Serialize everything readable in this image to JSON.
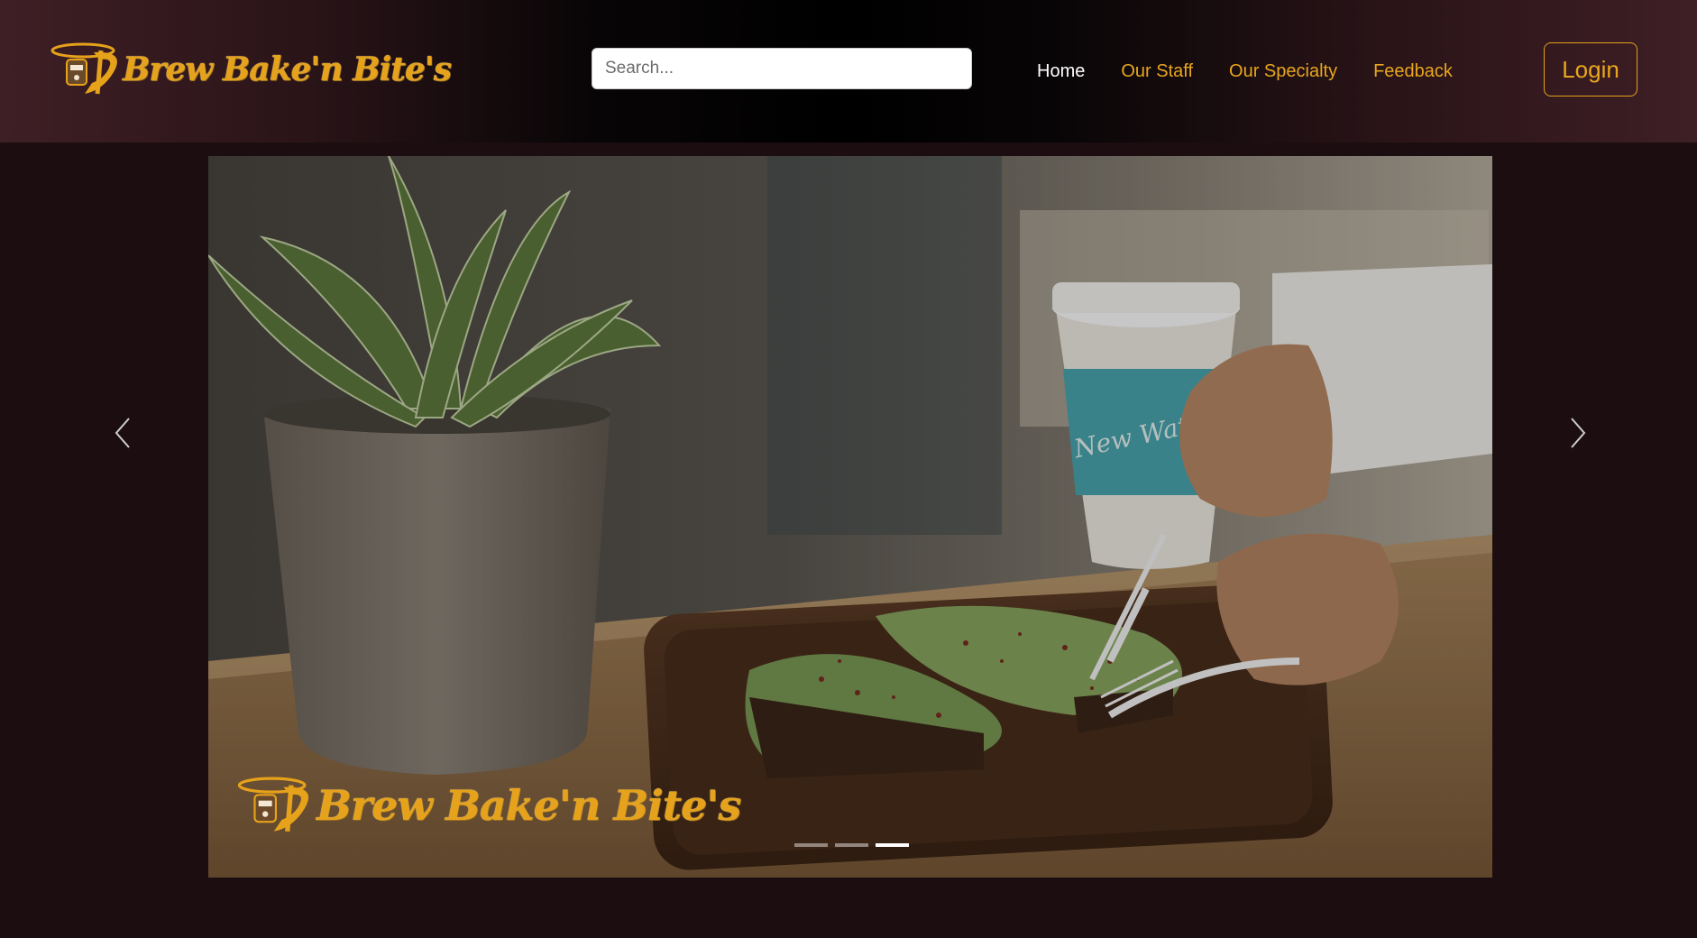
{
  "header": {
    "brand": "Brew Bake'n Bite's",
    "search": {
      "placeholder": "Search...",
      "value": ""
    },
    "nav": [
      {
        "label": "Home",
        "active": true
      },
      {
        "label": "Our Staff",
        "active": false
      },
      {
        "label": "Our Specialty",
        "active": false
      },
      {
        "label": "Feedback",
        "active": false
      }
    ],
    "login_label": "Login"
  },
  "carousel": {
    "caption_brand": "Brew Bake'n Bite's",
    "image": "avocado-toast-coffee-photo",
    "cup_print": "New Water",
    "slide_count": 3,
    "active_slide": 3,
    "prev_icon": "chevron-left-icon",
    "next_icon": "chevron-right-icon"
  },
  "colors": {
    "accent": "#e8a61e",
    "page_background": "#1b0d10",
    "nav_active": "#ffffff"
  }
}
